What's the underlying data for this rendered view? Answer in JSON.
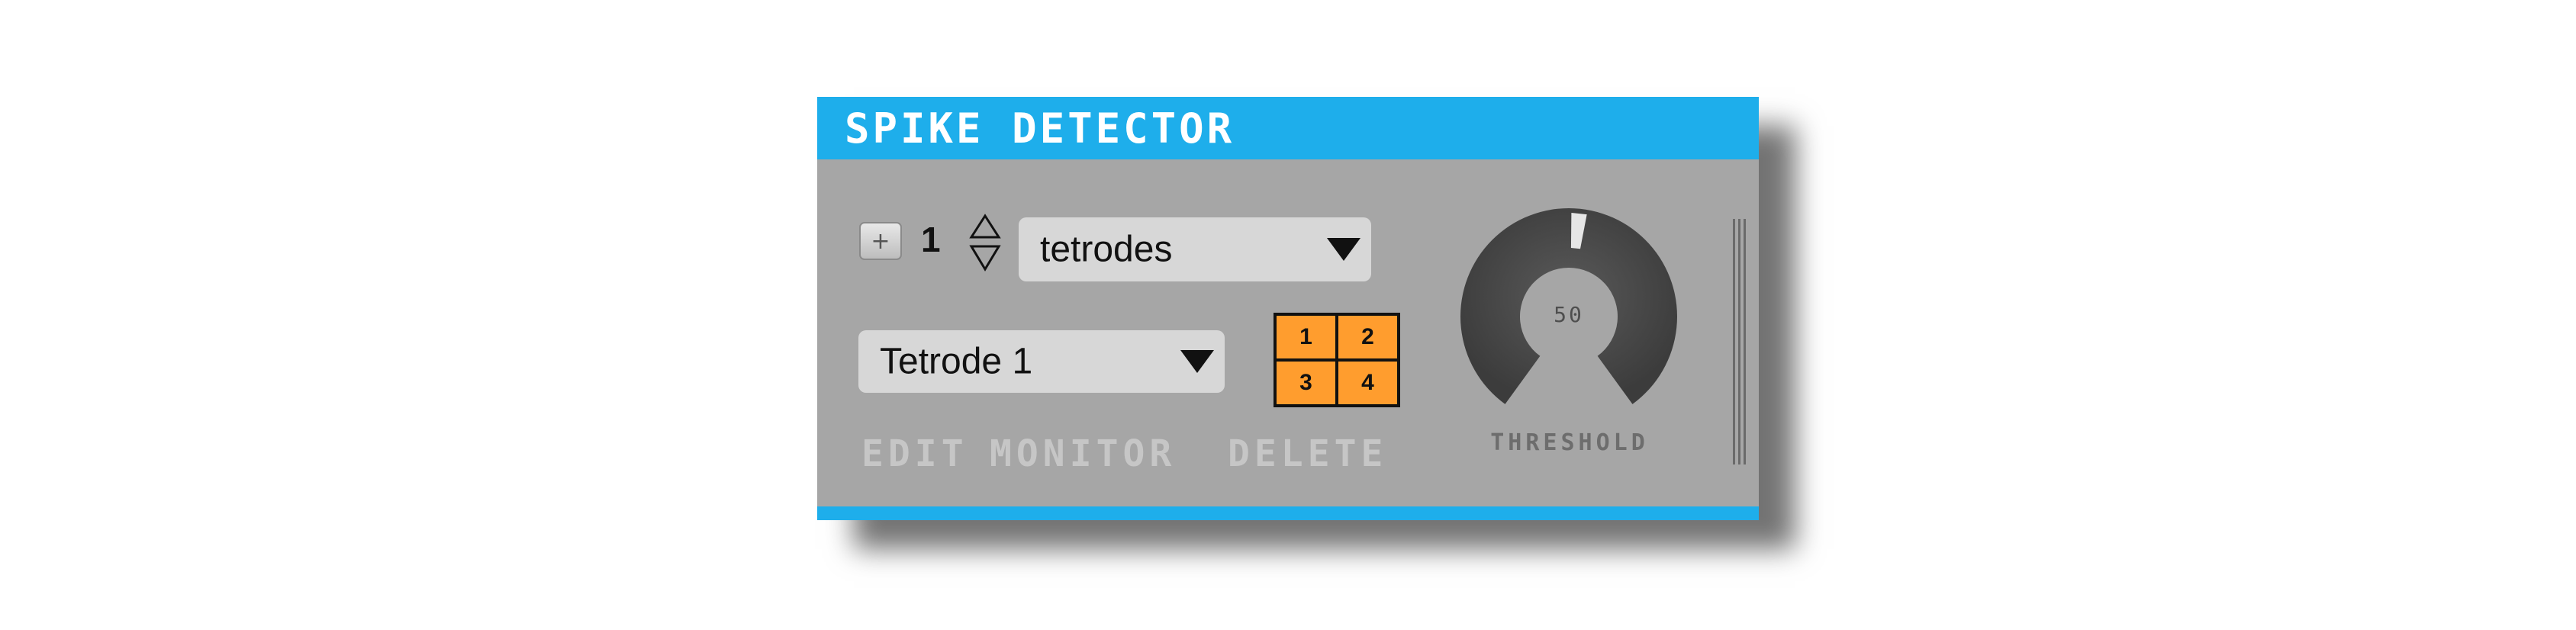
{
  "editor": {
    "title": "SPIKE DETECTOR",
    "colors": {
      "title_bar": "#1eaeeb",
      "body": "#a6a6a6",
      "channel_active": "#ff9d2e"
    }
  },
  "electrode_count": {
    "add_icon": "plus-icon",
    "add_label": "+",
    "value": "1",
    "stepper_icon": "up-down-triangles-icon"
  },
  "electrode_type": {
    "selected": "tetrodes",
    "arrow_icon": "triangle-down-icon"
  },
  "electrode_select": {
    "selected": "Tetrode 1",
    "arrow_icon": "triangle-down-icon"
  },
  "channels": [
    "1",
    "2",
    "3",
    "4"
  ],
  "actions": {
    "edit": "EDIT",
    "monitor": "MONITOR",
    "delete": "DELETE"
  },
  "threshold": {
    "value": "50",
    "label": "THRESHOLD"
  }
}
